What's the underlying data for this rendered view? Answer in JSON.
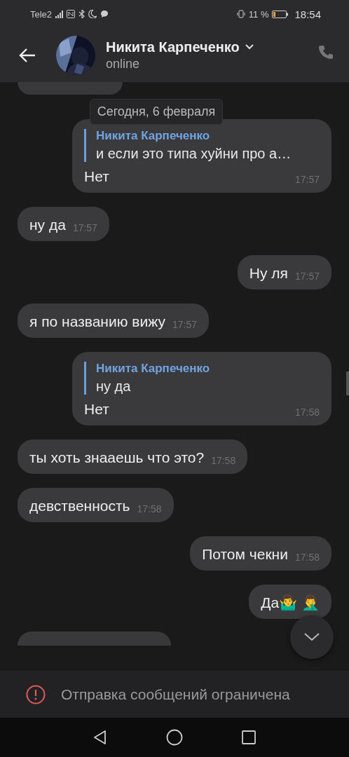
{
  "status_bar": {
    "carrier": "Tele2",
    "battery": "11 %",
    "time": "18:54"
  },
  "header": {
    "name": "Никита Карпеченко",
    "status": "online"
  },
  "date_chip": "Сегодня, 6 февраля",
  "messages": [
    {
      "kind": "outgoing",
      "reply": {
        "author": "Никита Карпеченко",
        "text": "и если это типа хуйни про а…"
      },
      "text": "Нет",
      "time": "17:57"
    },
    {
      "kind": "incoming",
      "text": "ну да",
      "time": "17:57"
    },
    {
      "kind": "outgoing",
      "text": "Ну ля",
      "time": "17:57"
    },
    {
      "kind": "incoming",
      "text": "я по названию вижу",
      "time": "17:57"
    },
    {
      "kind": "outgoing",
      "reply": {
        "author": "Никита Карпеченко",
        "text": "ну да"
      },
      "text": "Нет",
      "time": "17:58"
    },
    {
      "kind": "incoming",
      "text": "ты хоть знааешь что это?",
      "time": "17:58"
    },
    {
      "kind": "incoming",
      "text": "девственность",
      "time": "17:58"
    },
    {
      "kind": "outgoing",
      "text": "Потом чекни",
      "time": "17:58"
    },
    {
      "kind": "outgoing",
      "text": "Да🤷‍♂️ 🤦‍♂️"
    }
  ],
  "notice": "Отправка сообщений ограничена"
}
